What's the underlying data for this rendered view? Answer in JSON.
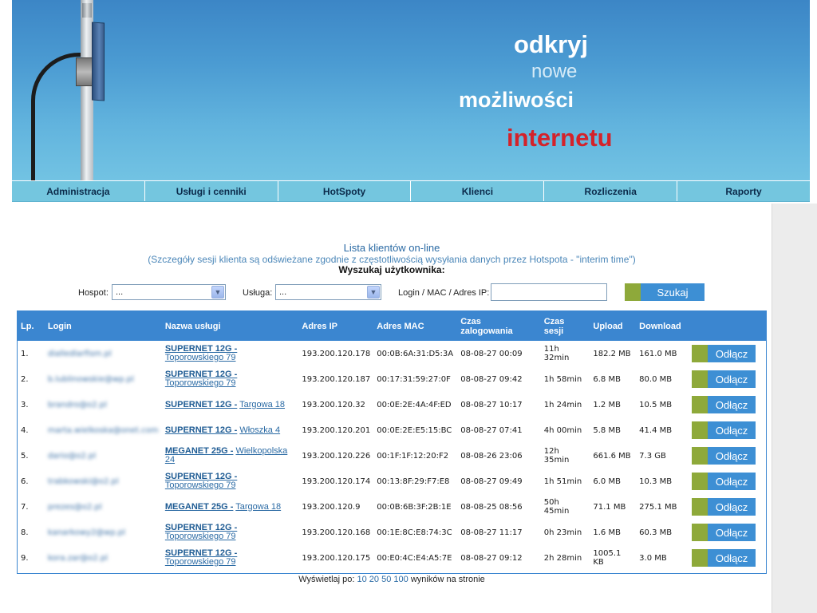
{
  "banner": {
    "line1": "odkryj",
    "line2": "nowe",
    "line3": "możliwości",
    "line4": "internetu"
  },
  "nav": [
    {
      "label": "Administracja"
    },
    {
      "label": "Usługi i cenniki"
    },
    {
      "label": "HotSpoty"
    },
    {
      "label": "Klienci"
    },
    {
      "label": "Rozliczenia"
    },
    {
      "label": "Raporty"
    }
  ],
  "page": {
    "title": "Lista klientów on-line",
    "subtitle": "(Szczegóły sesji klienta są odświeżane zgodnie z częstotliwością wysyłania danych przez Hotspota - \"interim time\")",
    "search_heading": "Wyszukaj użytkownika:"
  },
  "filters": {
    "hotspot_label": "Hospot:",
    "hotspot_value": "...",
    "service_label": "Usługa:",
    "service_value": "...",
    "login_label": "Login / MAC / Adres IP:",
    "login_value": "",
    "search_button": "Szukaj"
  },
  "table": {
    "headers": {
      "lp": "Lp.",
      "login": "Login",
      "service": "Nazwa usługi",
      "ip": "Adres IP",
      "mac": "Adres MAC",
      "login_time_1": "Czas",
      "login_time_2": "zalogowania",
      "session_1": "Czas",
      "session_2": "sesji",
      "upload": "Upload",
      "download": "Download"
    },
    "disconnect_label": "Odłącz",
    "rows": [
      {
        "lp": "1.",
        "login": "dialledlarfism.pl",
        "service_name": "SUPERNET 12G -",
        "service_addr": "Toporowskiego 79",
        "ip": "193.200.120.178",
        "mac": "00:0B:6A:31:D5:3A",
        "time": "08-08-27 00:09",
        "session": "11h 32min",
        "upload": "182.2 MB",
        "download": "161.0 MB"
      },
      {
        "lp": "2.",
        "login": "b.lublinowskie@wp.pl",
        "service_name": "SUPERNET 12G -",
        "service_addr": "Toporowskiego 79",
        "ip": "193.200.120.187",
        "mac": "00:17:31:59:27:0F",
        "time": "08-08-27 09:42",
        "session": "1h 58min",
        "upload": "6.8 MB",
        "download": "80.0 MB"
      },
      {
        "lp": "3.",
        "login": "brandro@o2.pl",
        "service_name": "SUPERNET 12G -",
        "service_addr": "Targowa 18",
        "ip": "193.200.120.32",
        "mac": "00:0E:2E:4A:4F:ED",
        "time": "08-08-27 10:17",
        "session": "1h 24min",
        "upload": "1.2 MB",
        "download": "10.5 MB"
      },
      {
        "lp": "4.",
        "login": "marta.wielkoska@onet.com",
        "service_name": "SUPERNET 12G -",
        "service_addr": "Włoszka 4",
        "ip": "193.200.120.201",
        "mac": "00:0E:2E:E5:15:BC",
        "time": "08-08-27 07:41",
        "session": "4h 00min",
        "upload": "5.8 MB",
        "download": "41.4 MB"
      },
      {
        "lp": "5.",
        "login": "dario@o2.pl",
        "service_name": "MEGANET 25G -",
        "service_addr": "Wielkopolska 24",
        "ip": "193.200.120.226",
        "mac": "00:1F:1F:12:20:F2",
        "time": "08-08-26 23:06",
        "session": "12h 35min",
        "upload": "661.6 MB",
        "download": "7.3 GB"
      },
      {
        "lp": "6.",
        "login": "trabkowski@o2.pl",
        "service_name": "SUPERNET 12G -",
        "service_addr": "Toporowskiego 79",
        "ip": "193.200.120.174",
        "mac": "00:13:8F:29:F7:E8",
        "time": "08-08-27 09:49",
        "session": "1h 51min",
        "upload": "6.0 MB",
        "download": "10.3 MB"
      },
      {
        "lp": "7.",
        "login": "prezes@o2.pl",
        "service_name": "MEGANET 25G -",
        "service_addr": "Targowa 18",
        "ip": "193.200.120.9",
        "mac": "00:0B:6B:3F:2B:1E",
        "time": "08-08-25 08:56",
        "session": "50h 45min",
        "upload": "71.1 MB",
        "download": "275.1 MB"
      },
      {
        "lp": "8.",
        "login": "kanarkowy2@wp.pl",
        "service_name": "SUPERNET 12G -",
        "service_addr": "Toporowskiego 79",
        "ip": "193.200.120.168",
        "mac": "00:1E:8C:E8:74:3C",
        "time": "08-08-27 11:17",
        "session": "0h 23min",
        "upload": "1.6 MB",
        "download": "60.3 MB"
      },
      {
        "lp": "9.",
        "login": "kora.zar@o2.pl",
        "service_name": "SUPERNET 12G -",
        "service_addr": "Toporowskiego 79",
        "ip": "193.200.120.175",
        "mac": "00:E0:4C:E4:A5:7E",
        "time": "08-08-27 09:12",
        "session": "2h 28min",
        "upload": "1005.1 KB",
        "download": "3.0 MB"
      }
    ]
  },
  "pager": {
    "prefix": "Wyświetlaj po:",
    "options": [
      "10",
      "20",
      "50",
      "100"
    ],
    "suffix": "wyników na stronie"
  },
  "colors": {
    "banner_top": "#3c86c6",
    "nav_bg": "#74c6df",
    "table_header": "#3b86d0",
    "button_blue": "#3d8fd4",
    "button_green": "#8ea93a",
    "slogan_red": "#d4222a"
  }
}
